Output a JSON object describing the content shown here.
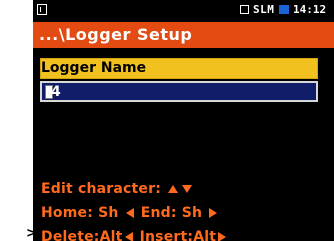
{
  "left_mark": ">",
  "statusbar": {
    "mode": "SLM",
    "time": "14:12",
    "left_icon": "file-icon",
    "square_icon": "square-icon",
    "battery_icon": "battery-icon",
    "battery_color": "#1a63d6"
  },
  "title": {
    "text": "...\\Logger Setup",
    "bg_color": "#e34b12"
  },
  "field": {
    "label": "Logger Name",
    "value": "4",
    "label_bg_color": "#f1c21f",
    "input_bg_color": "#101e6a",
    "cursor_icon": "text-cursor-icon"
  },
  "hints": {
    "line1_text": "Edit character: ",
    "line1_icon_1": "arrow-up-icon",
    "line1_icon_2": "arrow-down-icon",
    "line2_home": "Home: Sh ",
    "line2_home_icon": "arrow-left-icon",
    "line2_end": " End: Sh ",
    "line2_end_icon": "arrow-right-icon",
    "line3_delete": "Delete:Alt",
    "line3_delete_icon": "arrow-left-icon",
    "line3_insert": " Insert:Alt",
    "line3_insert_icon": "arrow-right-icon",
    "color": "#ff6a1c"
  }
}
